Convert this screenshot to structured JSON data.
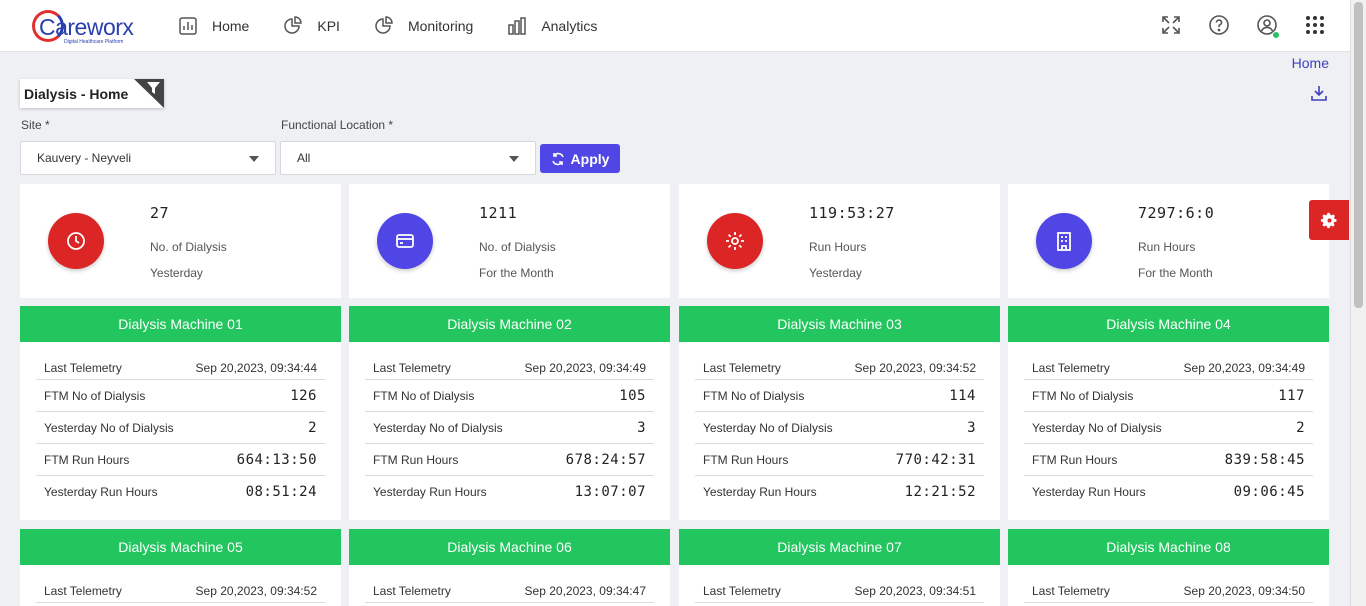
{
  "app": {
    "logo_text": "Careworx",
    "logo_tagline": "Digital Healthcare Platform"
  },
  "nav": [
    {
      "label": "Home",
      "icon": "bar-chart-icon"
    },
    {
      "label": "KPI",
      "icon": "pie-chart-icon"
    },
    {
      "label": "Monitoring",
      "icon": "pie-chart-icon"
    },
    {
      "label": "Analytics",
      "icon": "bar-chart-icon"
    }
  ],
  "breadcrumb": "Home",
  "page_title": "Dialysis - Home",
  "filters": {
    "site_label": "Site *",
    "site_value": "Kauvery - Neyveli",
    "location_label": "Functional Location *",
    "location_value": "All",
    "apply_label": "Apply"
  },
  "stats": [
    {
      "value": "27",
      "line1": "No. of Dialysis",
      "line2": "Yesterday",
      "icon": "clock-icon",
      "color": "#dc2626"
    },
    {
      "value": "1211",
      "line1": "No. of Dialysis",
      "line2": "For the Month",
      "icon": "card-icon",
      "color": "#4f46e5"
    },
    {
      "value": "119:53:27",
      "line1": "Run Hours",
      "line2": "Yesterday",
      "icon": "gear-icon",
      "color": "#dc2626"
    },
    {
      "value": "7297:6:0",
      "line1": "Run Hours",
      "line2": "For the Month",
      "icon": "building-icon",
      "color": "#4f46e5"
    }
  ],
  "row_labels": {
    "telemetry": "Last Telemetry",
    "ftm_dialysis": "FTM No of Dialysis",
    "yest_dialysis": "Yesterday No of Dialysis",
    "ftm_hours": "FTM Run Hours",
    "yest_hours": "Yesterday Run Hours"
  },
  "machines": [
    {
      "name": "Dialysis Machine 01",
      "telemetry": "Sep 20,2023, 09:34:44",
      "ftm_dialysis": "126",
      "yest_dialysis": "2",
      "ftm_hours": "664:13:50",
      "yest_hours": "08:51:24"
    },
    {
      "name": "Dialysis Machine 02",
      "telemetry": "Sep 20,2023, 09:34:49",
      "ftm_dialysis": "105",
      "yest_dialysis": "3",
      "ftm_hours": "678:24:57",
      "yest_hours": "13:07:07"
    },
    {
      "name": "Dialysis Machine 03",
      "telemetry": "Sep 20,2023, 09:34:52",
      "ftm_dialysis": "114",
      "yest_dialysis": "3",
      "ftm_hours": "770:42:31",
      "yest_hours": "12:21:52"
    },
    {
      "name": "Dialysis Machine 04",
      "telemetry": "Sep 20,2023, 09:34:49",
      "ftm_dialysis": "117",
      "yest_dialysis": "2",
      "ftm_hours": "839:58:45",
      "yest_hours": "09:06:45"
    },
    {
      "name": "Dialysis Machine 05",
      "telemetry": "Sep 20,2023, 09:34:52"
    },
    {
      "name": "Dialysis Machine 06",
      "telemetry": "Sep 20,2023, 09:34:47"
    },
    {
      "name": "Dialysis Machine 07",
      "telemetry": "Sep 20,2023, 09:34:51"
    },
    {
      "name": "Dialysis Machine 08",
      "telemetry": "Sep 20,2023, 09:34:50"
    }
  ],
  "colors": {
    "primary": "#4f46e5",
    "danger": "#dc2626",
    "success": "#22c55e"
  }
}
